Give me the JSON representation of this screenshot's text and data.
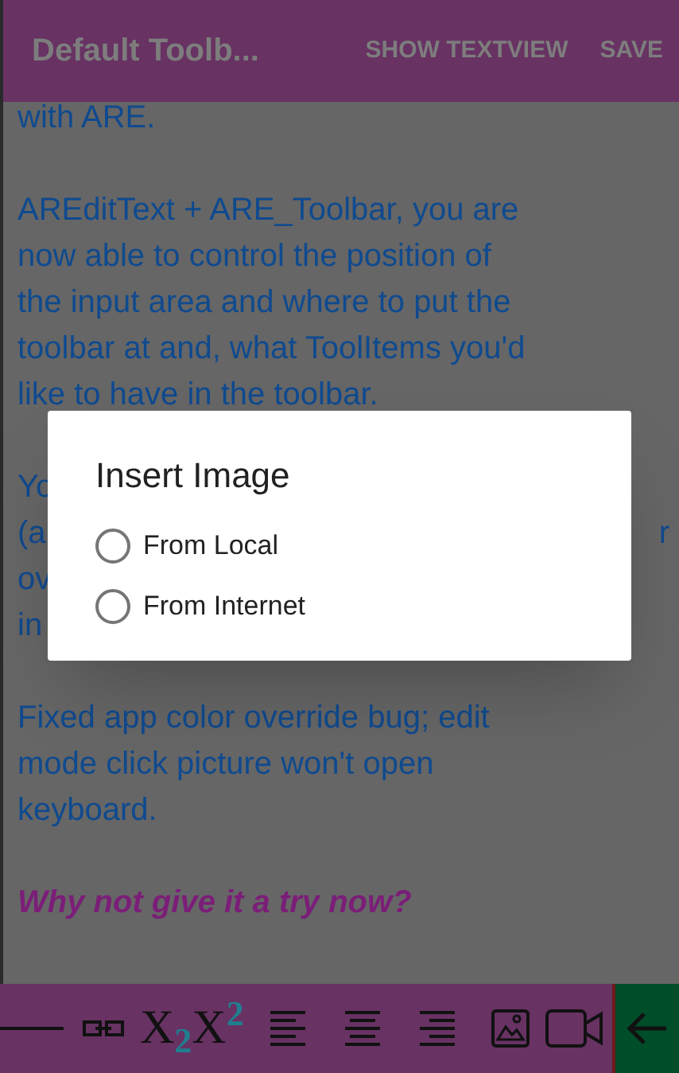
{
  "app_bar": {
    "title": "Default Toolb...",
    "actions": [
      "SHOW TEXTVIEW",
      "SAVE"
    ]
  },
  "editor": {
    "paragraphs": [
      {
        "kind": "plain",
        "lines": [
          "with ARE."
        ]
      },
      {
        "kind": "plain",
        "lines": [
          "AREditText + ARE_Toolbar, you are",
          "now able to control the position of",
          "the input area and where to put the",
          "toolbar at and, what ToolItems you'd",
          "like to have in the toolbar."
        ]
      },
      {
        "kind": "covered",
        "lines": [
          {
            "left": "Yo"
          },
          {
            "left": "(a",
            "right": "r"
          },
          {
            "left": "ov"
          },
          {
            "left": "in"
          }
        ]
      },
      {
        "kind": "plain",
        "lines": [
          "Fixed app color override bug; edit",
          "mode click picture won't open",
          "keyboard."
        ]
      },
      {
        "kind": "emphasis",
        "lines": [
          "Why not give it a try now?"
        ]
      }
    ]
  },
  "toolbar": {
    "items": [
      {
        "kind": "rule"
      },
      {
        "kind": "link"
      },
      {
        "kind": "script",
        "label": "X$_{2}$"
      },
      {
        "kind": "script",
        "label": "X$^{2}$"
      },
      {
        "kind": "align-left"
      },
      {
        "kind": "align-center"
      },
      {
        "kind": "align-right"
      },
      {
        "kind": "image"
      },
      {
        "kind": "video"
      },
      {
        "kind": "back"
      }
    ]
  },
  "dialog": {
    "title": "Insert Image",
    "options": [
      {
        "label": "From Local",
        "selected": false
      },
      {
        "label": "From Internet",
        "selected": false
      }
    ]
  }
}
